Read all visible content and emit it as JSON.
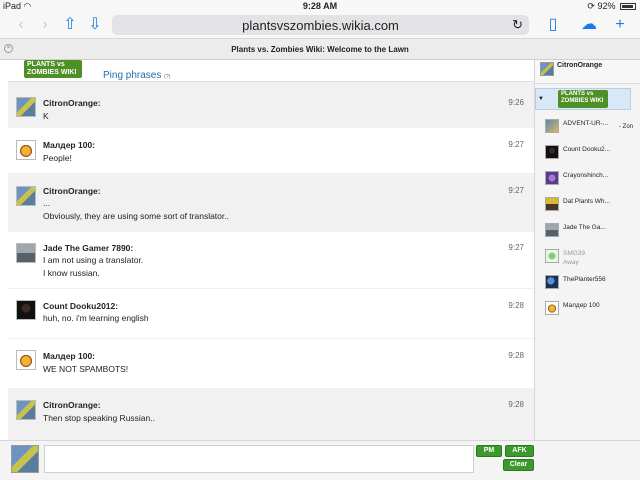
{
  "status_bar": {
    "device": "iPad",
    "wifi_icon": "wifi-icon",
    "time": "9:28 AM",
    "battery": "92%"
  },
  "browser": {
    "url": "plantsvszombies.wikia.com",
    "tab_title": "Plants vs. Zombies Wiki: Welcome to the Lawn",
    "icons": [
      "back-icon",
      "forward-icon",
      "share-icon",
      "download-icon",
      "reload-icon",
      "bookmarks-icon",
      "cloud-icon",
      "new-tab-icon"
    ]
  },
  "chat": {
    "logo_text": "PLANTS vs ZOMBIES WIKI",
    "ping_phrases": "Ping phrases",
    "ping_count": "(?)",
    "messages": [
      {
        "user": "CitronOrange:",
        "time": "9:26",
        "lines": [
          "K"
        ]
      },
      {
        "user": "Малдер 100:",
        "time": "9:27",
        "lines": [
          "People!"
        ]
      },
      {
        "user": "CitronOrange:",
        "time": "9:27",
        "lines": [
          "...",
          "Obviously, they are using some sort of translator.."
        ]
      },
      {
        "user": "Jade The Gamer 7890:",
        "time": "9:27",
        "lines": [
          "I am not using a translator.",
          "I know russian."
        ]
      },
      {
        "user": "Count Dooku2012:",
        "time": "9:28",
        "lines": [
          "huh, no. i'm learning english"
        ]
      },
      {
        "user": "Малдер 100:",
        "time": "9:28",
        "lines": [
          "WE NOT SPAMBOTS!"
        ]
      },
      {
        "user": "CitronOrange:",
        "time": "9:28",
        "lines": [
          "Then stop speaking Russian.."
        ]
      }
    ]
  },
  "sidebar": {
    "current_user": "CitronOrange",
    "room_logo_text": "PLANTS vs ZOMBIES WIKI",
    "users": [
      {
        "name": "ADVENT-UR-...",
        "extra": "- Zon"
      },
      {
        "name": "Count Dooku2..."
      },
      {
        "name": "Crayonshinch..."
      },
      {
        "name": "Dat Plants Wh..."
      },
      {
        "name": "Jade The Ga..."
      },
      {
        "name": "SMG39",
        "status": "Away"
      },
      {
        "name": "ThePlanter556"
      },
      {
        "name": "Малдер 100"
      }
    ]
  },
  "footer": {
    "pm_label": "PM",
    "afk_label": "AFK",
    "clear_label": "Clear",
    "message_value": ""
  }
}
